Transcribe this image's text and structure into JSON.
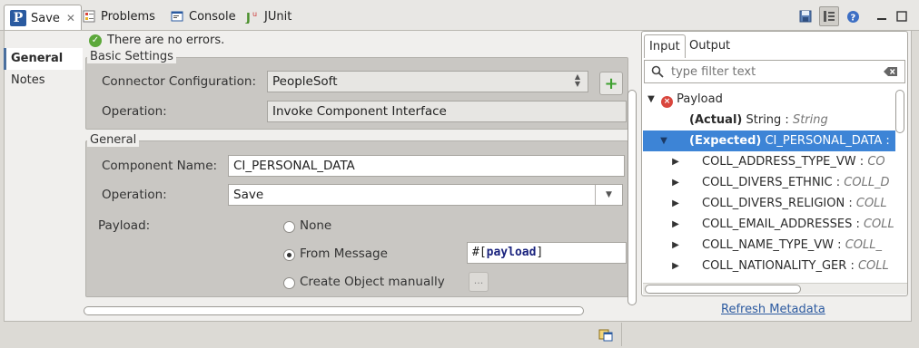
{
  "tabs": [
    {
      "label": "Save",
      "icon": "peoplesoft-icon",
      "active": true
    },
    {
      "label": "Problems",
      "icon": "problems-icon"
    },
    {
      "label": "Console",
      "icon": "console-icon"
    },
    {
      "label": "JUnit",
      "icon": "junit-icon"
    }
  ],
  "toolbar": {
    "save_icon": "save-icon",
    "layout_icon": "layout-icon",
    "help_icon": "help-icon",
    "minimize_icon": "minimize-icon",
    "maximize_icon": "maximize-icon"
  },
  "side_tabs": [
    {
      "label": "General"
    },
    {
      "label": "Notes"
    }
  ],
  "status": {
    "message": "There are no errors."
  },
  "basic": {
    "legend": "Basic Settings",
    "connector_label": "Connector Configuration:",
    "connector_value": "PeopleSoft",
    "operation_label": "Operation:",
    "operation_value": "Invoke Component Interface"
  },
  "general": {
    "legend": "General",
    "component_label": "Component Name:",
    "component_value": "CI_PERSONAL_DATA",
    "operation_label": "Operation:",
    "operation_value": "Save",
    "payload_label": "Payload:",
    "options": [
      "None",
      "From Message",
      "Create Object manually"
    ],
    "selected_option": "From Message",
    "expression_prefix": "#[",
    "expression_keyword": "payload",
    "expression_suffix": "]",
    "dots_label": "..."
  },
  "metadata": {
    "tabs": [
      "Input",
      "Output"
    ],
    "filter_placeholder": "type filter text",
    "root": "Payload",
    "actual_label": "(Actual)",
    "actual_name": "String",
    "actual_type": "String",
    "expected_label": "(Expected)",
    "expected_name": "CI_PERSONAL_DATA :",
    "children": [
      {
        "name": "COLL_ADDRESS_TYPE_VW",
        "type": "CO"
      },
      {
        "name": "COLL_DIVERS_ETHNIC",
        "type": "COLL_D"
      },
      {
        "name": "COLL_DIVERS_RELIGION",
        "type": "COLL"
      },
      {
        "name": "COLL_EMAIL_ADDRESSES",
        "type": "COLL"
      },
      {
        "name": "COLL_NAME_TYPE_VW",
        "type": "COLL_"
      },
      {
        "name": "COLL_NATIONALITY_GER",
        "type": "COLL"
      }
    ],
    "refresh_label": "Refresh Metadata"
  },
  "colors": {
    "selection": "#3d84d6",
    "ok": "#5ca83a",
    "error": "#d9463d",
    "link": "#2c5aa0",
    "keyword": "#1a237e"
  }
}
